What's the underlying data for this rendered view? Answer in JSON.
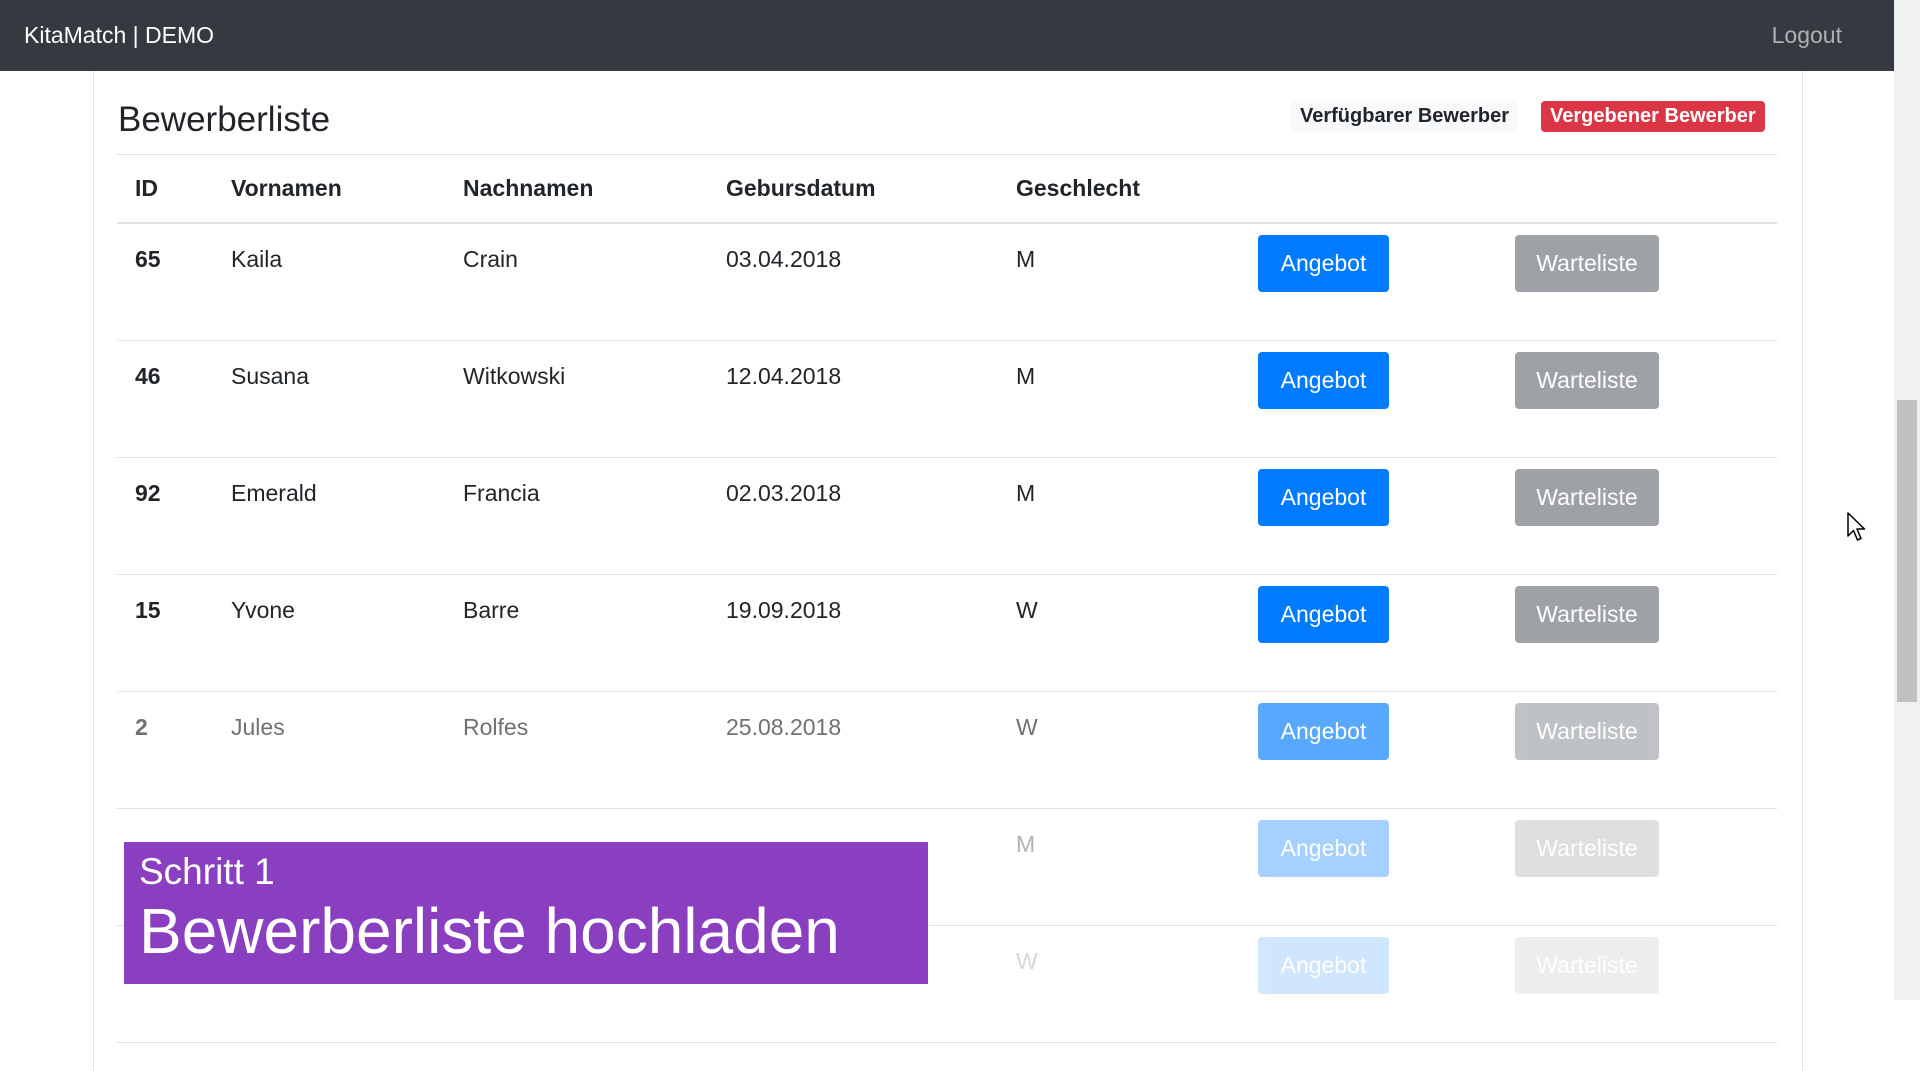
{
  "navbar": {
    "brand": "KitaMatch | DEMO",
    "logout": "Logout"
  },
  "card": {
    "title": "Bewerberliste",
    "badge_available": "Verfügbarer Bewerber",
    "badge_assigned": "Vergebener Bewerber"
  },
  "table": {
    "headers": [
      "ID",
      "Vornamen",
      "Nachnamen",
      "Gebursdatum",
      "Geschlecht"
    ],
    "rows": [
      {
        "id": "65",
        "first": "Kaila",
        "last": "Crain",
        "dob": "03.04.2018",
        "gender": "M",
        "offer": "Angebot",
        "wait": "Warteliste"
      },
      {
        "id": "46",
        "first": "Susana",
        "last": "Witkowski",
        "dob": "12.04.2018",
        "gender": "M",
        "offer": "Angebot",
        "wait": "Warteliste"
      },
      {
        "id": "92",
        "first": "Emerald",
        "last": "Francia",
        "dob": "02.03.2018",
        "gender": "M",
        "offer": "Angebot",
        "wait": "Warteliste"
      },
      {
        "id": "15",
        "first": "Yvone",
        "last": "Barre",
        "dob": "19.09.2018",
        "gender": "W",
        "offer": "Angebot",
        "wait": "Warteliste"
      },
      {
        "id": "2",
        "first": "Jules",
        "last": "Rolfes",
        "dob": "25.08.2018",
        "gender": "W",
        "offer": "Angebot",
        "wait": "Warteliste"
      },
      {
        "id": "",
        "first": "",
        "last": "",
        "dob": "",
        "gender": "M",
        "offer": "Angebot",
        "wait": "Warteliste"
      },
      {
        "id": "",
        "first": "",
        "last": "",
        "dob": "",
        "gender": "W",
        "offer": "Angebot",
        "wait": "Warteliste"
      }
    ]
  },
  "overlay": {
    "step": "Schritt 1",
    "title": "Bewerberliste hochladen"
  },
  "icons": {
    "cursor": "mouse-pointer-icon"
  },
  "colors": {
    "navbar": "#343a40",
    "primary": "#007bff",
    "secondary": "#9ea2a6",
    "danger": "#dc3545",
    "overlay": "#8a3ec0"
  }
}
